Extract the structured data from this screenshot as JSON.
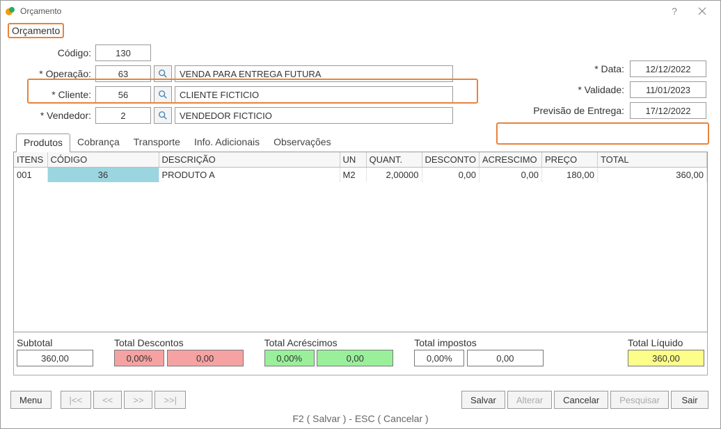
{
  "window": {
    "title": "Orçamento"
  },
  "menu": {
    "orcamento": "Orçamento"
  },
  "form": {
    "codigo_label": "Código:",
    "codigo": "130",
    "operacao_label": "* Operação:",
    "operacao_code": "63",
    "operacao_desc": "VENDA PARA ENTREGA FUTURA",
    "cliente_label": "* Cliente:",
    "cliente_code": "56",
    "cliente_desc": "CLIENTE FICTICIO",
    "vendedor_label": "* Vendedor:",
    "vendedor_code": "2",
    "vendedor_desc": "VENDEDOR FICTICIO",
    "data_label": "* Data:",
    "data": "12/12/2022",
    "validade_label": "* Validade:",
    "validade": "11/01/2023",
    "entrega_label": "Previsão de Entrega:",
    "entrega": "17/12/2022"
  },
  "tabs": {
    "produtos": "Produtos",
    "cobranca": "Cobrança",
    "transporte": "Transporte",
    "info": "Info. Adicionais",
    "obs": "Observações"
  },
  "grid": {
    "headers": {
      "itens": "ITENS",
      "codigo": "CÓDIGO",
      "descricao": "DESCRIÇÃO",
      "un": "UN",
      "quant": "QUANT.",
      "desconto": "DESCONTO",
      "acrescimo": "ACRESCIMO",
      "preco": "PREÇO",
      "total": "TOTAL"
    },
    "rows": [
      {
        "itens": "001",
        "codigo": "36",
        "descricao": "PRODUTO A",
        "un": "M2",
        "quant": "2,00000",
        "desconto": "0,00",
        "acrescimo": "0,00",
        "preco": "180,00",
        "total": "360,00"
      }
    ]
  },
  "totals": {
    "subtotal_label": "Subtotal",
    "subtotal": "360,00",
    "desc_label": "Total Descontos",
    "desc_pct": "0,00%",
    "desc_val": "0,00",
    "acre_label": "Total Acréscimos",
    "acre_pct": "0,00%",
    "acre_val": "0,00",
    "imp_label": "Total impostos",
    "imp_pct": "0,00%",
    "imp_val": "0,00",
    "liq_label": "Total Líquido",
    "liq_val": "360,00"
  },
  "footer": {
    "menu": "Menu",
    "first": "|<<",
    "prev": "<<",
    "next": ">>",
    "last": ">>|",
    "salvar": "Salvar",
    "alterar": "Alterar",
    "cancelar": "Cancelar",
    "pesquisar": "Pesquisar",
    "sair": "Sair",
    "status": "F2 ( Salvar )  -  ESC ( Cancelar )"
  }
}
